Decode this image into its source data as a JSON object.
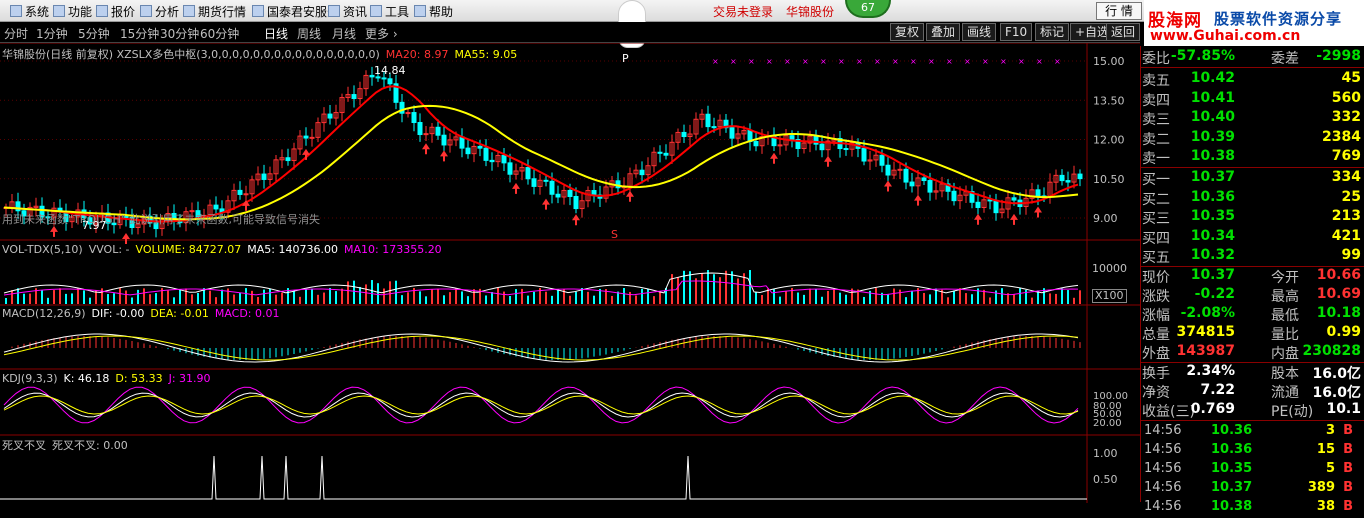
{
  "menu": [
    "系统",
    "功能",
    "报价",
    "分析",
    "期货行情",
    "国泰君安服务",
    "资讯",
    "工具",
    "帮助"
  ],
  "notice": {
    "login": "交易未登录",
    "stock": "华锦股份"
  },
  "badge": "67",
  "quote_button": "行 情",
  "logo": {
    "name": "股海网",
    "slogan": "股票软件资源分享",
    "url": "www.Guhai.com.cn"
  },
  "periods": [
    "分时",
    "1分钟",
    "5分钟",
    "15分钟",
    "30分钟",
    "60分钟",
    "日线",
    "周线",
    "月线",
    "更多 ›"
  ],
  "active_period": "日线",
  "tools": [
    "复权",
    "叠加",
    "画线",
    "F10",
    "标记",
    "+自选",
    "返回"
  ],
  "main_panel": {
    "title": "华锦股份(日线 前复权) XZSLX多色中枢(3,0,0,0,0,0,0,0,0,0,0,0,0,0,0,0,0)",
    "ma20": "MA20: 8.97",
    "ma55": "MA55: 9.05",
    "high": "14.84",
    "low": "7.97",
    "note": "用到未来函数\"TROUGH\" 此说引用了未来函数,可能导致信号消失",
    "sym_p": "P",
    "sym_s": "S",
    "y_labels": [
      "15.00",
      "13.50",
      "12.00",
      "10.50",
      "9.00"
    ]
  },
  "vol_panel": {
    "title": "VOL-TDX(5,10)",
    "vvol": "VVOL: -",
    "volume": "VOLUME: 84727.07",
    "ma5": "MA5: 140736.00",
    "ma10": "MA10: 173355.20",
    "y_label": "10000",
    "unit": "X100"
  },
  "macd_panel": {
    "title": "MACD(12,26,9)",
    "dif": "DIF: -0.00",
    "dea": "DEA: -0.01",
    "macd": "MACD: 0.01"
  },
  "kdj_panel": {
    "title": "KDJ(9,3,3)",
    "k": "K: 46.18",
    "d": "D: 53.33",
    "j": "J: 31.90",
    "y_labels": [
      "100.00",
      "80.00",
      "50.00",
      "20.00"
    ]
  },
  "cross_panel": {
    "title": "死叉不叉",
    "value": "死叉不叉: 0.00",
    "y_labels": [
      "1.00",
      "0.50"
    ]
  },
  "colors": {
    "up": "#ff3232",
    "down": "#00ffff",
    "ma20": "#ff0000",
    "ma55": "#ffff00",
    "yellow": "#ffff00",
    "green": "#00e000",
    "magenta": "#ff00ff",
    "white": "#ffffff"
  },
  "quote": {
    "committee": {
      "label": "委比",
      "value": "-57.85%",
      "label2": "委差",
      "value2": "-2998"
    },
    "asks": [
      {
        "label": "卖五",
        "price": "10.42",
        "vol": "45"
      },
      {
        "label": "卖四",
        "price": "10.41",
        "vol": "560"
      },
      {
        "label": "卖三",
        "price": "10.40",
        "vol": "332"
      },
      {
        "label": "卖二",
        "price": "10.39",
        "vol": "2384"
      },
      {
        "label": "卖一",
        "price": "10.38",
        "vol": "769"
      }
    ],
    "bids": [
      {
        "label": "买一",
        "price": "10.37",
        "vol": "334"
      },
      {
        "label": "买二",
        "price": "10.36",
        "vol": "25"
      },
      {
        "label": "买三",
        "price": "10.35",
        "vol": "213"
      },
      {
        "label": "买四",
        "price": "10.34",
        "vol": "421"
      },
      {
        "label": "买五",
        "price": "10.32",
        "vol": "99"
      }
    ],
    "stats": [
      {
        "l1": "现价",
        "v1": "10.37",
        "c1": "green",
        "l2": "今开",
        "v2": "10.66",
        "c2": "red"
      },
      {
        "l1": "涨跌",
        "v1": "-0.22",
        "c1": "green",
        "l2": "最高",
        "v2": "10.69",
        "c2": "red"
      },
      {
        "l1": "涨幅",
        "v1": "-2.08%",
        "c1": "green",
        "l2": "最低",
        "v2": "10.18",
        "c2": "green"
      },
      {
        "l1": "总量",
        "v1": "374815",
        "c1": "yellow",
        "l2": "量比",
        "v2": "0.99",
        "c2": "yellow"
      },
      {
        "l1": "外盘",
        "v1": "143987",
        "c1": "red",
        "l2": "内盘",
        "v2": "230828",
        "c2": "green"
      }
    ],
    "stats2": [
      {
        "l1": "换手",
        "v1": "2.34%",
        "l2": "股本",
        "v2": "16.0亿"
      },
      {
        "l1": "净资",
        "v1": "7.22",
        "l2": "流通",
        "v2": "16.0亿"
      },
      {
        "l1": "收益(三)",
        "v1": "0.769",
        "l2": "PE(动)",
        "v2": "10.1"
      }
    ],
    "ticks": [
      {
        "time": "14:56",
        "price": "10.36",
        "vol": "3",
        "flag": "B"
      },
      {
        "time": "14:56",
        "price": "10.36",
        "vol": "15",
        "flag": "B"
      },
      {
        "time": "14:56",
        "price": "10.35",
        "vol": "5",
        "flag": "B"
      },
      {
        "time": "14:56",
        "price": "10.37",
        "vol": "389",
        "flag": "B"
      },
      {
        "time": "14:56",
        "price": "10.38",
        "vol": "38",
        "flag": "B"
      }
    ]
  }
}
